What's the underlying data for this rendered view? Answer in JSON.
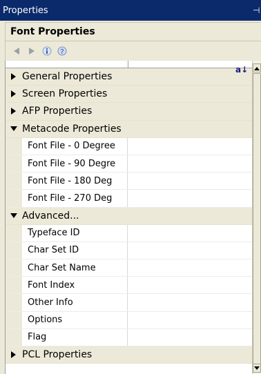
{
  "window": {
    "title": "Properties"
  },
  "panel": {
    "header": "Font Properties"
  },
  "toolbar": {
    "buttons": [
      {
        "icon": "back-arrow-icon"
      },
      {
        "icon": "forward-arrow-icon"
      },
      {
        "icon": "info-icon"
      },
      {
        "icon": "help-icon"
      }
    ]
  },
  "sort_icon_label": "a↓",
  "grid": {
    "rows": [
      {
        "kind": "category",
        "label": "General Properties",
        "expanded": false
      },
      {
        "kind": "category",
        "label": "Screen Properties",
        "expanded": false
      },
      {
        "kind": "category",
        "label": "AFP Properties",
        "expanded": false
      },
      {
        "kind": "category",
        "label": "Metacode Properties",
        "expanded": true
      },
      {
        "kind": "property",
        "label": "Font File - 0 Degree",
        "value": ""
      },
      {
        "kind": "property",
        "label": "Font File - 90 Degre",
        "value": ""
      },
      {
        "kind": "property",
        "label": "Font File - 180 Deg",
        "value": ""
      },
      {
        "kind": "property",
        "label": "Font File - 270 Deg",
        "value": ""
      },
      {
        "kind": "category",
        "label": "Advanced...",
        "expanded": true,
        "sub": true
      },
      {
        "kind": "property",
        "label": "Typeface ID",
        "value": ""
      },
      {
        "kind": "property",
        "label": "Char Set ID",
        "value": ""
      },
      {
        "kind": "property",
        "label": "Char Set Name",
        "value": ""
      },
      {
        "kind": "property",
        "label": "Font Index",
        "value": ""
      },
      {
        "kind": "property",
        "label": "Other Info",
        "value": ""
      },
      {
        "kind": "property",
        "label": "Options",
        "value": ""
      },
      {
        "kind": "property",
        "label": "Flag",
        "value": ""
      },
      {
        "kind": "category",
        "label": "PCL Properties",
        "expanded": false
      }
    ]
  },
  "colors": {
    "titlebar": "#0b2a6b",
    "panel": "#ece9d8",
    "grid_bg": "#ffffff"
  }
}
